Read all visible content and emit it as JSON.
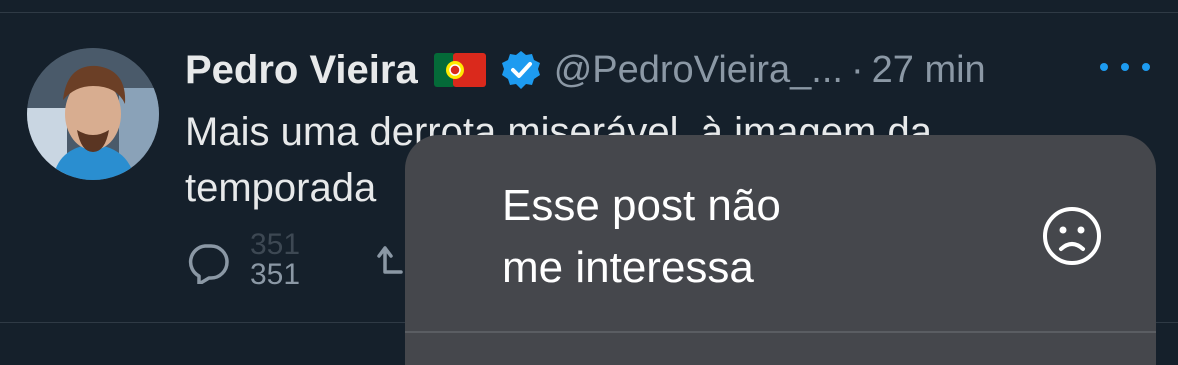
{
  "tweet": {
    "author_name": "Pedro Vieira",
    "handle": "@PedroVieira_...",
    "separator": "·",
    "time": "27 min",
    "text_line1": "Mais uma derrota miserável, à imagem da",
    "text_line2": "temporada",
    "reply_count": "351",
    "reply_count_previous": "351"
  },
  "menu": {
    "item_label_line1": "Esse post não",
    "item_label_line2": "me interessa"
  },
  "colors": {
    "background": "#15202b",
    "accent": "#1d9bf0",
    "secondary_text": "#8b98a5",
    "menu_background": "#45474c"
  },
  "icons": [
    "flag-portugal-icon",
    "verified-badge-icon",
    "more-options-icon",
    "reply-icon",
    "retweet-icon",
    "sad-face-icon"
  ]
}
